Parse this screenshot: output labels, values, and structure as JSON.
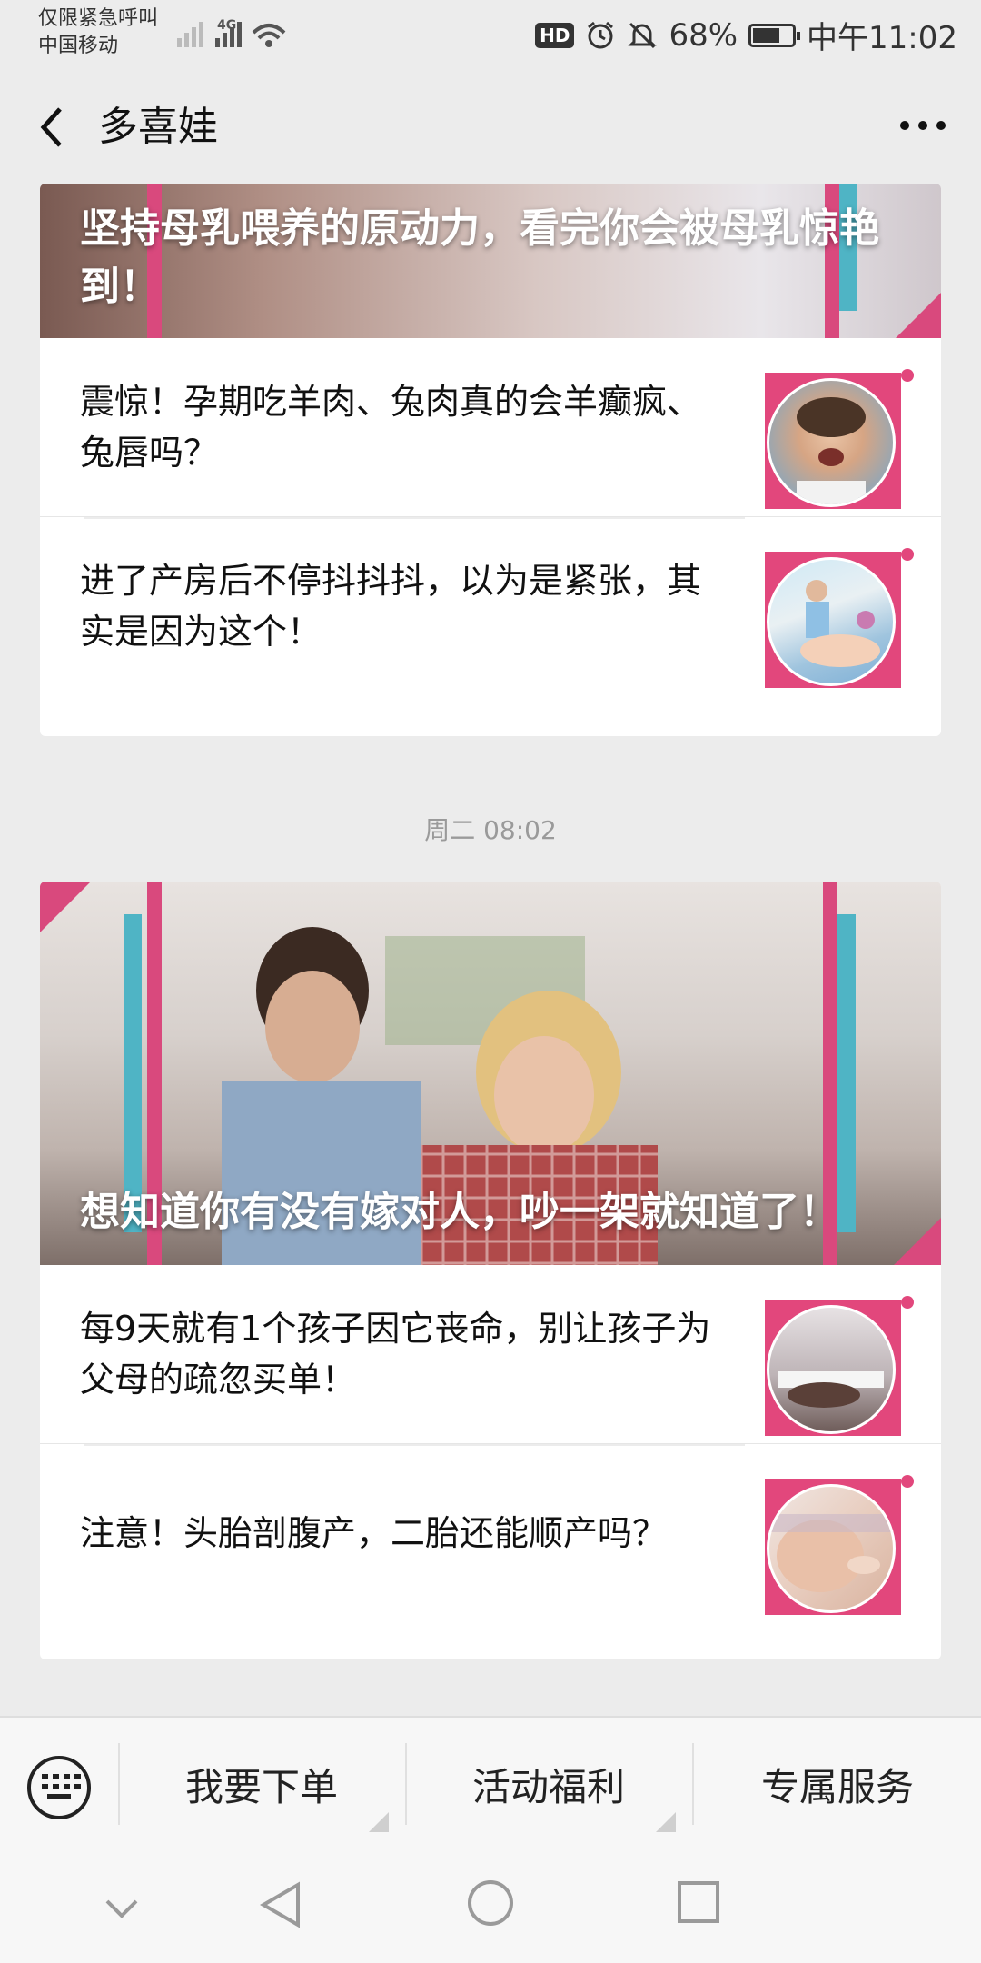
{
  "status_bar": {
    "carrier_line1": "仅限紧急呼叫",
    "carrier_line2": "中国移动",
    "network": "4G",
    "hd": "HD",
    "battery_percent": "68%",
    "battery_level": 0.68,
    "time": "中午11:02"
  },
  "nav": {
    "title": "多喜娃",
    "back_icon": "chevron-left",
    "more_icon": "ellipsis"
  },
  "card1": {
    "cover_title": "坚持母乳喂养的原动力，看完你会被母乳惊艳到！",
    "items": [
      {
        "text": "震惊！孕期吃羊肉、兔肉真的会羊癫疯、兔唇吗？",
        "thumb": "crying-child"
      },
      {
        "text": "进了产房后不停抖抖抖，以为是紧张，其实是因为这个！",
        "thumb": "delivery-room"
      }
    ]
  },
  "timestamp": "周二 08:02",
  "card2": {
    "cover_title": "想知道你有没有嫁对人，吵一架就知道了！",
    "items": [
      {
        "text": "每9天就有1个孩子因它丧命，别让孩子为父母的疏忽买单！",
        "thumb": "child-at-window"
      },
      {
        "text": "注意！头胎剖腹产，二胎还能顺产吗？",
        "thumb": "pregnant-belly"
      }
    ]
  },
  "bottom_menu": {
    "keyboard_icon": "keyboard",
    "items": [
      "我要下单",
      "活动福利",
      "专属服务"
    ]
  },
  "colors": {
    "accent_pink": "#e2477c",
    "accent_cyan": "#4fb4c5",
    "background": "#ececec"
  }
}
